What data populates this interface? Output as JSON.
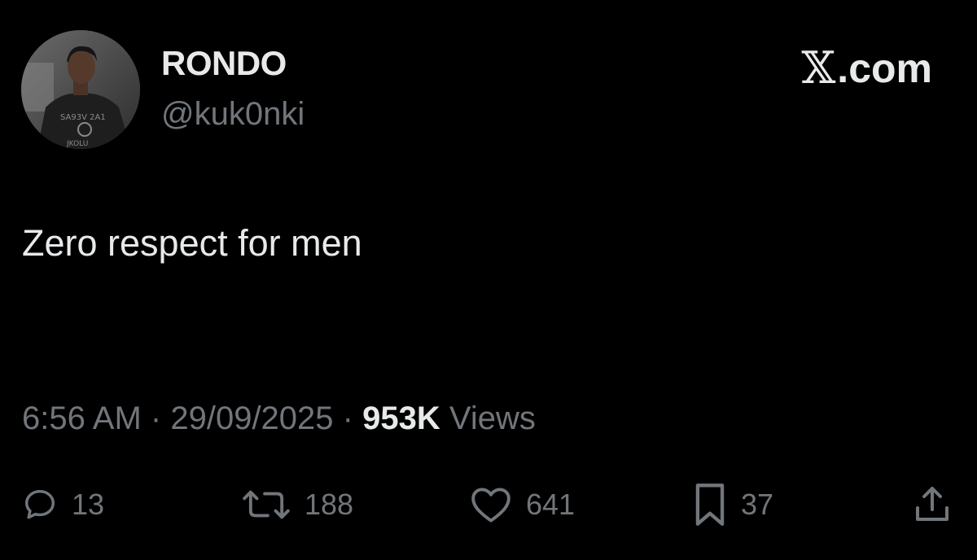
{
  "author": {
    "display_name": "RONDO",
    "handle": "@kuk0nki",
    "avatar_icon": "profile-photo"
  },
  "brand": {
    "label": ".com",
    "logo_glyph": "𝕏"
  },
  "tweet": {
    "text": "Zero respect for men"
  },
  "meta": {
    "time": "6:56 AM",
    "date": "29/09/2025",
    "views_count": "953K",
    "views_label": "Views",
    "separator": "·"
  },
  "actions": {
    "replies": "13",
    "reposts": "188",
    "likes": "641",
    "bookmarks": "37"
  },
  "colors": {
    "background": "#000000",
    "primary_text": "#e7e9ea",
    "secondary_text": "#71767b"
  }
}
